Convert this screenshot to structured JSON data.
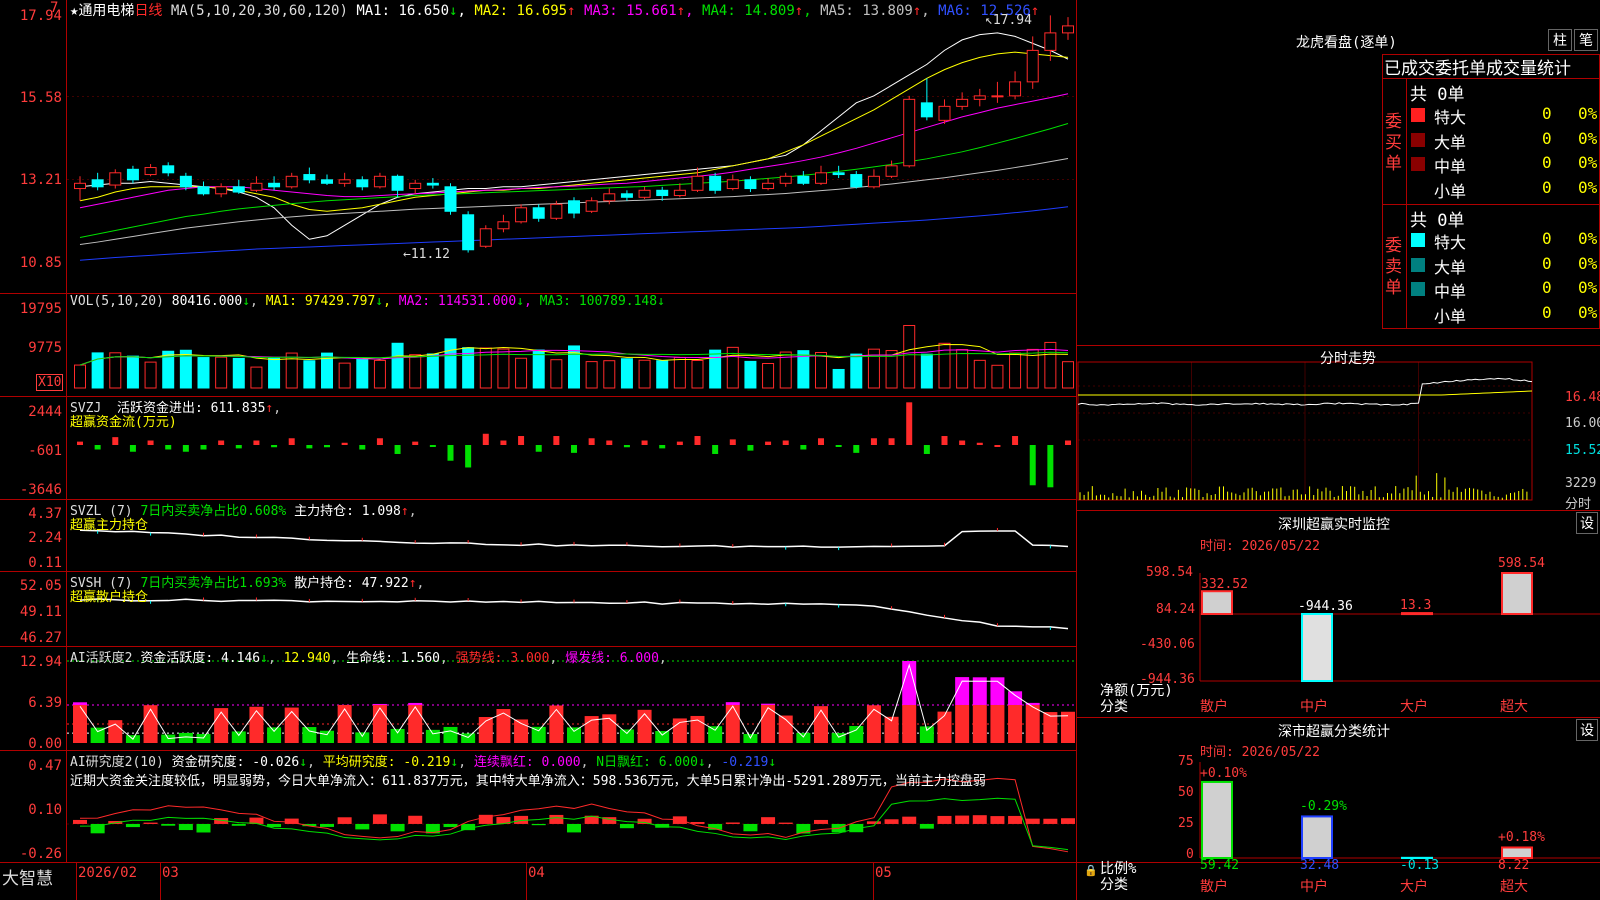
{
  "colors": {
    "up": "#ff2a2a",
    "down": "#00ffff",
    "green": "#00e000",
    "ma1": "#ffffff",
    "ma2": "#ffff00",
    "ma3": "#ff00ff",
    "ma4": "#00e000",
    "ma5": "#c0c0c0",
    "ma6": "#1e3cff",
    "grid": "#b00000"
  },
  "main": {
    "header": {
      "star": "★",
      "name": "通用电梯",
      "period": "日线",
      "ma_def": "MA(5,10,20,30,60,120)",
      "ma": [
        {
          "label": "MA1:",
          "value": "16.650",
          "arrow": "↓"
        },
        {
          "label": "MA2:",
          "value": "16.695",
          "arrow": "↑"
        },
        {
          "label": "MA3:",
          "value": "15.661",
          "arrow": "↑"
        },
        {
          "label": "MA4:",
          "value": "14.809",
          "arrow": "↑"
        },
        {
          "label": "MA5:",
          "value": "13.809",
          "arrow": "↑"
        },
        {
          "label": "MA6:",
          "value": "12.526",
          "arrow": "↑"
        }
      ]
    },
    "y_labels": [
      "17.94",
      "15.58",
      "13.21",
      "10.85"
    ],
    "hi_mark": "17.94",
    "lo_mark": "11.12",
    "corner_mark": "7"
  },
  "vol": {
    "header": {
      "def": "VOL(5,10,20)",
      "value": "80416.000",
      "arrow": "↓",
      "ma": [
        {
          "label": "MA1:",
          "value": "97429.797",
          "arrow": "↓"
        },
        {
          "label": "MA2:",
          "value": "114531.000",
          "arrow": "↓"
        },
        {
          "label": "MA3:",
          "value": "100789.148",
          "arrow": "↓"
        }
      ]
    },
    "y_labels": [
      "19795",
      "9775"
    ],
    "unit": "X10"
  },
  "svzj": {
    "header": {
      "def": "SVZJ",
      "label": "活跃资金进出:",
      "value": "611.835",
      "arrow": "↑",
      "sub": "超赢资金流(万元)"
    },
    "y_labels": [
      "2444",
      "-601",
      "-3646"
    ]
  },
  "svzl": {
    "header": {
      "def": "SVZL (7)",
      "ratio": "7日内买卖净占比0.608%",
      "label": "主力持仓:",
      "value": "1.098",
      "arrow": "↑",
      "sub": "超赢主力持仓"
    },
    "y_labels": [
      "4.37",
      "2.24",
      "0.11"
    ]
  },
  "svsh": {
    "header": {
      "def": "SVSH (7)",
      "ratio": "7日内买卖净占比1.693%",
      "label": "散户持仓:",
      "value": "47.922",
      "arrow": "↑",
      "sub": "超赢散户持仓"
    },
    "y_labels": [
      "52.05",
      "49.11",
      "46.27"
    ]
  },
  "ai2": {
    "header": {
      "def": "AI活跃度2",
      "label": "资金活跃度:",
      "value": "4.146",
      "arrow": "↓",
      "v2": "12.940",
      "life_label": "生命线:",
      "life": "1.560",
      "strong": "强势线: 3.000",
      "burst": "爆发线: 6.000"
    },
    "y_labels": [
      "12.94",
      "6.39",
      "0.00"
    ]
  },
  "ai_res": {
    "header": {
      "def": "AI研究度2(10)",
      "label": "资金研究度:",
      "value": "-0.026",
      "avg_label": "平均研究度:",
      "avg": "-0.219",
      "streak": "连续飘红: 0.000",
      "nred": "N日飘红: 6.000",
      "last": "-0.219"
    },
    "text": "近期大资金关注度较低，明显弱势，今日大单净流入：611.837万元，其中特大单净流入：598.536万元，大单5日累计净出-5291.289万元，当前主力控盘弱",
    "y_labels": [
      "0.47",
      "0.10",
      "-0.26"
    ]
  },
  "bottom": {
    "logo": "大智慧",
    "dates": [
      "2026/02",
      "03",
      "04",
      "05"
    ]
  },
  "dragon": {
    "title": "龙虎看盘(逐单)",
    "btn1": "柱",
    "btn2": "笔",
    "head": "已成交委托单成交量统计",
    "buy": {
      "side": "委买单",
      "total": "共 0单",
      "rows": [
        {
          "name": "特大",
          "count": "0",
          "pct": "0%"
        },
        {
          "name": "大单",
          "count": "0",
          "pct": "0%"
        },
        {
          "name": "中单",
          "count": "0",
          "pct": "0%"
        },
        {
          "name": "小单",
          "count": "0",
          "pct": "0%"
        }
      ]
    },
    "sell": {
      "side": "委卖单",
      "total": "共 0单",
      "rows": [
        {
          "name": "特大",
          "count": "0",
          "pct": "0%"
        },
        {
          "name": "大单",
          "count": "0",
          "pct": "0%"
        },
        {
          "name": "中单",
          "count": "0",
          "pct": "0%"
        },
        {
          "name": "小单",
          "count": "0",
          "pct": "0%"
        }
      ]
    }
  },
  "intraday": {
    "title": "分时走势",
    "y_labels": [
      "16.48",
      "16.00",
      "15.52"
    ],
    "vol_label": "3229",
    "unit": "分时"
  },
  "sz_monitor": {
    "title": "深圳超赢实时监控",
    "btn": "设",
    "time": "时间: 2026/05/22",
    "y_labels": [
      "598.54",
      "84.24",
      "-430.06",
      "-944.36"
    ],
    "unit1": "净额(万元)",
    "unit2": "分类",
    "cats": [
      "散户",
      "中户",
      "大户",
      "超大"
    ],
    "vals": [
      "332.52",
      "-944.36",
      "13.3",
      "598.54"
    ]
  },
  "sz_class": {
    "title": "深市超赢分类统计",
    "btn": "设",
    "time": "时间: 2026/05/22",
    "y_labels": [
      "75",
      "50",
      "25",
      "0"
    ],
    "unit1": "比例%",
    "unit2": "分类",
    "cats": [
      "散户",
      "中户",
      "大户",
      "超大"
    ],
    "tops": [
      "+0.10%",
      "-0.29%",
      "",
      "+0.18%"
    ],
    "bottoms": [
      "59.42",
      "32.48",
      "-0.13",
      "8.22"
    ]
  },
  "chart_data": {
    "type": "candlestick",
    "x_axis": {
      "labels": [
        "2026/02",
        "03",
        "04",
        "05"
      ]
    },
    "price": {
      "ylim": [
        10.85,
        17.94
      ],
      "high": 17.94,
      "low": 11.12
    },
    "series": [
      {
        "name": "MA1",
        "values": [
          13.0,
          13.05,
          13.1,
          13.1,
          13.15,
          13.1,
          13.05,
          13.0,
          12.95,
          12.85,
          12.7,
          12.4,
          11.9,
          11.5,
          11.6,
          11.9,
          12.2,
          12.5,
          12.7,
          12.8,
          12.85,
          12.9,
          12.95,
          12.95,
          13.0,
          13.0,
          13.05,
          13.1,
          13.15,
          13.2,
          13.25,
          13.3,
          13.35,
          13.4,
          13.45,
          13.5,
          13.55,
          13.6,
          13.7,
          13.8,
          13.9,
          14.2,
          14.6,
          15.0,
          15.4,
          15.6,
          15.9,
          16.2,
          16.5,
          16.9,
          17.2,
          17.35,
          17.4,
          17.3,
          17.1,
          16.9,
          16.65
        ]
      },
      {
        "name": "MA2",
        "values": [
          12.6,
          12.7,
          12.85,
          12.95,
          13.0,
          13.0,
          13.0,
          13.0,
          12.95,
          12.9,
          12.8,
          12.7,
          12.5,
          12.35,
          12.3,
          12.35,
          12.4,
          12.5,
          12.6,
          12.7,
          12.75,
          12.8,
          12.85,
          12.9,
          12.9,
          12.95,
          12.95,
          13.0,
          13.05,
          13.1,
          13.15,
          13.2,
          13.25,
          13.3,
          13.35,
          13.4,
          13.5,
          13.6,
          13.7,
          13.8,
          14.0,
          14.2,
          14.45,
          14.7,
          14.95,
          15.2,
          15.5,
          15.8,
          16.1,
          16.35,
          16.55,
          16.7,
          16.8,
          16.85,
          16.8,
          16.75,
          16.7
        ]
      },
      {
        "name": "MA3",
        "values": [
          12.4,
          12.5,
          12.6,
          12.7,
          12.8,
          12.9,
          12.95,
          13.0,
          13.0,
          13.0,
          12.95,
          12.9,
          12.85,
          12.8,
          12.75,
          12.72,
          12.72,
          12.75,
          12.78,
          12.8,
          12.82,
          12.85,
          12.88,
          12.9,
          12.92,
          12.95,
          12.98,
          13.0,
          13.02,
          13.05,
          13.08,
          13.1,
          13.15,
          13.2,
          13.25,
          13.3,
          13.35,
          13.42,
          13.5,
          13.58,
          13.66,
          13.75,
          13.85,
          13.97,
          14.1,
          14.25,
          14.4,
          14.55,
          14.7,
          14.85,
          15.0,
          15.12,
          15.25,
          15.35,
          15.45,
          15.55,
          15.66
        ]
      },
      {
        "name": "MA4",
        "values": [
          11.55,
          11.65,
          11.75,
          11.85,
          11.95,
          12.05,
          12.15,
          12.22,
          12.3,
          12.37,
          12.42,
          12.47,
          12.52,
          12.56,
          12.6,
          12.63,
          12.66,
          12.69,
          12.72,
          12.75,
          12.77,
          12.79,
          12.81,
          12.83,
          12.85,
          12.87,
          12.89,
          12.91,
          12.93,
          12.95,
          12.97,
          12.99,
          13.01,
          13.04,
          13.07,
          13.1,
          13.13,
          13.16,
          13.2,
          13.24,
          13.28,
          13.33,
          13.38,
          13.44,
          13.5,
          13.57,
          13.64,
          13.72,
          13.8,
          13.9,
          14.0,
          14.12,
          14.25,
          14.38,
          14.52,
          14.66,
          14.81
        ]
      },
      {
        "name": "MA5",
        "values": [
          11.35,
          11.42,
          11.5,
          11.58,
          11.66,
          11.74,
          11.82,
          11.88,
          11.94,
          12.0,
          12.05,
          12.1,
          12.14,
          12.18,
          12.21,
          12.24,
          12.27,
          12.3,
          12.33,
          12.36,
          12.38,
          12.4,
          12.42,
          12.44,
          12.46,
          12.48,
          12.5,
          12.52,
          12.54,
          12.56,
          12.58,
          12.6,
          12.62,
          12.64,
          12.66,
          12.68,
          12.7,
          12.72,
          12.75,
          12.78,
          12.81,
          12.85,
          12.89,
          12.93,
          12.98,
          13.03,
          13.08,
          13.14,
          13.2,
          13.26,
          13.33,
          13.4,
          13.47,
          13.55,
          13.63,
          13.72,
          13.81
        ]
      },
      {
        "name": "MA6",
        "values": [
          10.9,
          10.94,
          10.98,
          11.01,
          11.04,
          11.07,
          11.1,
          11.13,
          11.16,
          11.19,
          11.22,
          11.24,
          11.26,
          11.28,
          11.3,
          11.32,
          11.34,
          11.36,
          11.38,
          11.4,
          11.42,
          11.44,
          11.46,
          11.48,
          11.5,
          11.52,
          11.54,
          11.56,
          11.58,
          11.6,
          11.62,
          11.64,
          11.66,
          11.68,
          11.7,
          11.72,
          11.74,
          11.76,
          11.78,
          11.8,
          11.82,
          11.84,
          11.87,
          11.9,
          11.93,
          11.96,
          11.99,
          12.02,
          12.05,
          12.09,
          12.13,
          12.17,
          12.21,
          12.26,
          12.31,
          12.37,
          12.43
        ]
      }
    ],
    "candles": [
      [
        12.95,
        13.1,
        13.3,
        12.6
      ],
      [
        13.2,
        13.0,
        13.4,
        12.9
      ],
      [
        13.05,
        13.4,
        13.5,
        12.95
      ],
      [
        13.5,
        13.2,
        13.6,
        13.1
      ],
      [
        13.35,
        13.55,
        13.65,
        13.3
      ],
      [
        13.6,
        13.4,
        13.7,
        13.3
      ],
      [
        13.3,
        13.0,
        13.4,
        12.9
      ],
      [
        13.0,
        12.8,
        13.15,
        12.75
      ],
      [
        12.8,
        13.0,
        13.1,
        12.7
      ],
      [
        13.0,
        12.85,
        13.2,
        12.8
      ],
      [
        12.9,
        13.1,
        13.3,
        12.85
      ],
      [
        13.1,
        13.0,
        13.3,
        12.9
      ],
      [
        13.0,
        13.3,
        13.4,
        12.95
      ],
      [
        13.35,
        13.2,
        13.55,
        13.1
      ],
      [
        13.2,
        13.1,
        13.35,
        13.05
      ],
      [
        13.1,
        13.2,
        13.4,
        13.0
      ],
      [
        13.2,
        13.0,
        13.3,
        12.9
      ],
      [
        13.0,
        13.3,
        13.4,
        12.95
      ],
      [
        13.3,
        12.9,
        13.35,
        12.7
      ],
      [
        12.95,
        13.1,
        13.2,
        12.8
      ],
      [
        13.1,
        13.05,
        13.25,
        12.95
      ],
      [
        13.0,
        12.3,
        13.1,
        12.2
      ],
      [
        12.2,
        11.2,
        12.3,
        11.12
      ],
      [
        11.3,
        11.8,
        11.9,
        11.25
      ],
      [
        11.8,
        12.0,
        12.2,
        11.7
      ],
      [
        12.0,
        12.4,
        12.5,
        11.95
      ],
      [
        12.4,
        12.1,
        12.5,
        12.0
      ],
      [
        12.1,
        12.5,
        12.6,
        12.05
      ],
      [
        12.6,
        12.25,
        12.7,
        12.1
      ],
      [
        12.3,
        12.6,
        12.7,
        12.25
      ],
      [
        12.6,
        12.8,
        12.95,
        12.5
      ],
      [
        12.8,
        12.7,
        12.9,
        12.6
      ],
      [
        12.7,
        12.9,
        13.0,
        12.65
      ],
      [
        12.9,
        12.75,
        13.0,
        12.6
      ],
      [
        12.75,
        12.9,
        13.1,
        12.7
      ],
      [
        12.9,
        13.3,
        13.55,
        12.85
      ],
      [
        13.3,
        12.9,
        13.4,
        12.8
      ],
      [
        12.95,
        13.2,
        13.35,
        12.9
      ],
      [
        13.2,
        12.95,
        13.3,
        12.85
      ],
      [
        12.95,
        13.1,
        13.25,
        12.9
      ],
      [
        13.1,
        13.3,
        13.4,
        13.0
      ],
      [
        13.3,
        13.1,
        13.45,
        13.05
      ],
      [
        13.1,
        13.4,
        13.6,
        13.05
      ],
      [
        13.4,
        13.35,
        13.6,
        13.25
      ],
      [
        13.35,
        13.0,
        13.45,
        12.95
      ],
      [
        13.0,
        13.3,
        13.5,
        12.95
      ],
      [
        13.3,
        13.6,
        13.75,
        13.25
      ],
      [
        13.6,
        15.5,
        15.6,
        13.55
      ],
      [
        15.4,
        15.0,
        16.1,
        14.9
      ],
      [
        14.9,
        15.3,
        15.5,
        14.8
      ],
      [
        15.3,
        15.5,
        15.7,
        15.2
      ],
      [
        15.5,
        15.6,
        15.8,
        15.3
      ],
      [
        15.6,
        15.6,
        16.0,
        15.4
      ],
      [
        15.6,
        16.0,
        16.3,
        15.5
      ],
      [
        16.0,
        16.9,
        17.3,
        15.8
      ],
      [
        16.9,
        17.4,
        17.9,
        16.6
      ],
      [
        17.4,
        17.6,
        17.85,
        17.2
      ]
    ]
  }
}
